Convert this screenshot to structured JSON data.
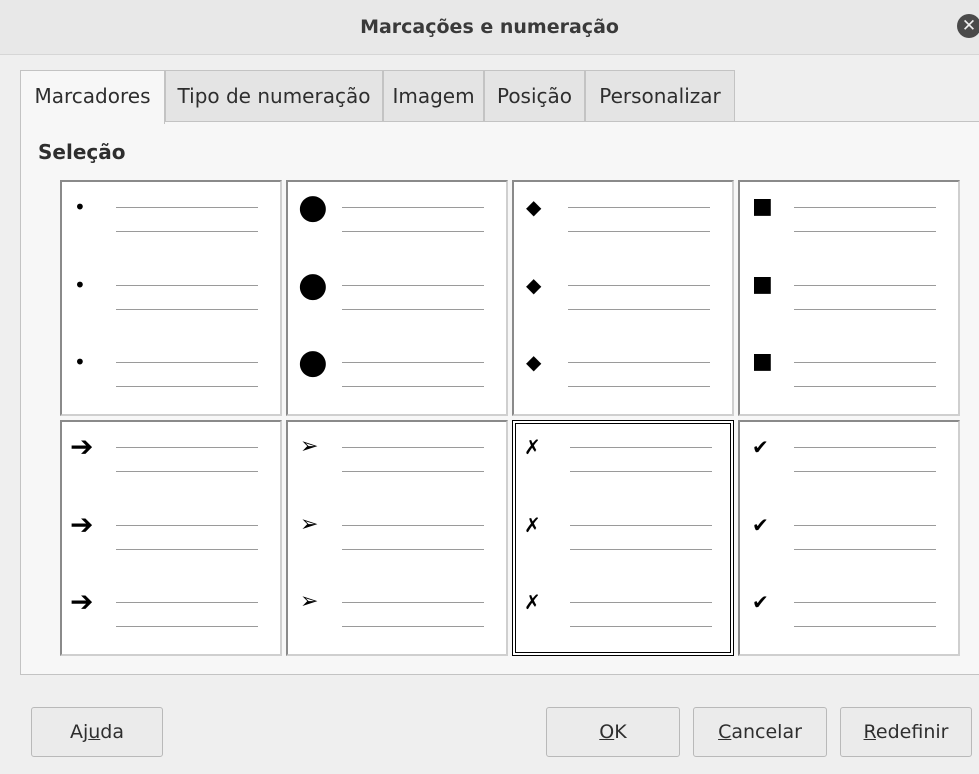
{
  "window": {
    "title": "Marcações e numeração"
  },
  "tabs": [
    {
      "label": "Marcadores"
    },
    {
      "label": "Tipo de numeração"
    },
    {
      "label": "Imagem"
    },
    {
      "label": "Posição"
    },
    {
      "label": "Personalizar"
    }
  ],
  "section": {
    "label": "Seleção"
  },
  "bullet_styles": [
    {
      "symbol": "•",
      "icon": "small-dot-bullet-icon"
    },
    {
      "symbol": "●",
      "icon": "large-dot-bullet-icon"
    },
    {
      "symbol": "◆",
      "icon": "diamond-bullet-icon"
    },
    {
      "symbol": "■",
      "icon": "square-bullet-icon"
    },
    {
      "symbol": "➔",
      "icon": "arrow-bullet-icon"
    },
    {
      "symbol": "➢",
      "icon": "arrowhead-bullet-icon"
    },
    {
      "symbol": "✗",
      "icon": "cross-bullet-icon",
      "selected": true
    },
    {
      "symbol": "✔",
      "icon": "check-bullet-icon"
    }
  ],
  "buttons": {
    "help": {
      "pre": "Aj",
      "key": "u",
      "post": "da"
    },
    "ok": {
      "pre": "",
      "key": "O",
      "post": "K"
    },
    "cancel": {
      "pre": "",
      "key": "C",
      "post": "ancelar"
    },
    "reset": {
      "pre": "",
      "key": "R",
      "post": "edefinir"
    }
  }
}
